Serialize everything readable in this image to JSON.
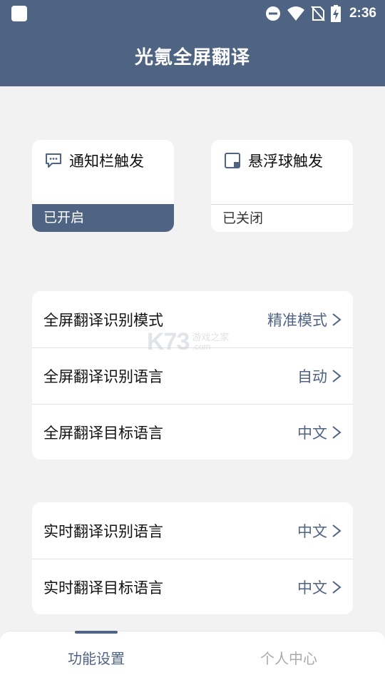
{
  "status_bar": {
    "time": "2:36",
    "icons": [
      "notification-square-icon",
      "dnd-minus-icon",
      "wifi-icon",
      "no-sim-icon",
      "battery-charging-icon"
    ]
  },
  "header": {
    "title": "光氪全屏翻译"
  },
  "triggers": [
    {
      "label": "通知栏触发",
      "status": "已开启",
      "enabled": true,
      "icon": "chat-bubble-icon"
    },
    {
      "label": "悬浮球触发",
      "status": "已关闭",
      "enabled": false,
      "icon": "float-window-icon"
    }
  ],
  "fullscreen_settings": [
    {
      "label": "全屏翻译识别模式",
      "value": "精准模式"
    },
    {
      "label": "全屏翻译识别语言",
      "value": "自动"
    },
    {
      "label": "全屏翻译目标语言",
      "value": "中文"
    }
  ],
  "realtime_settings": [
    {
      "label": "实时翻译识别语言",
      "value": "中文"
    },
    {
      "label": "实时翻译目标语言",
      "value": "中文"
    }
  ],
  "watermark": {
    "brand": "K73",
    "cn": "游戏之家",
    "com": ".com"
  },
  "tabs": [
    {
      "label": "功能设置",
      "active": true
    },
    {
      "label": "个人中心",
      "active": false
    }
  ],
  "colors": {
    "primary": "#4f6383",
    "background": "#f2f2f2",
    "card": "#ffffff"
  }
}
